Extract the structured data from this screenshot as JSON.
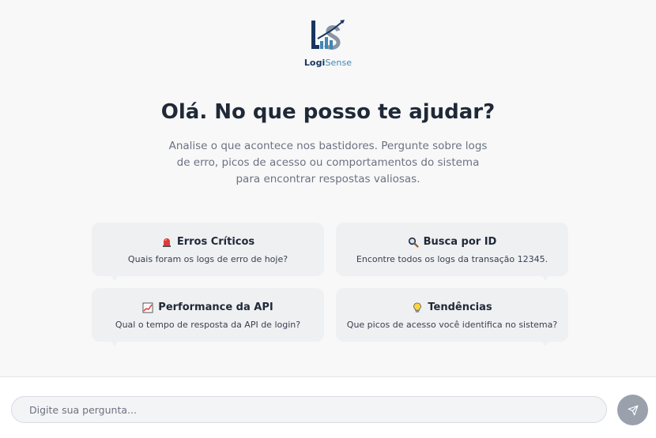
{
  "brand": {
    "name_part1": "Logi",
    "name_part2": "Sense",
    "icon": "logisense-logo"
  },
  "hero": {
    "title": "Olá. No que posso te ajudar?",
    "subtitle": "Analise o que acontece nos bastidores. Pergunte sobre logs de erro, picos de acesso ou comportamentos do sistema para encontrar respostas valiosas."
  },
  "suggestions": [
    {
      "icon": "siren-icon",
      "title": "Erros Críticos",
      "description": "Quais foram os logs de erro de hoje?"
    },
    {
      "icon": "magnifier-icon",
      "title": "Busca por ID",
      "description": "Encontre todos os logs da transação 12345."
    },
    {
      "icon": "chart-increasing-icon",
      "title": "Performance da API",
      "description": "Qual o tempo de resposta da API de login?"
    },
    {
      "icon": "lightbulb-icon",
      "title": "Tendências",
      "description": "Que picos de acesso você identifica no sistema?"
    }
  ],
  "composer": {
    "placeholder": "Digite sua pergunta...",
    "send_icon": "send-icon"
  },
  "colors": {
    "brand_dark": "#17355f",
    "brand_light": "#3f87b6",
    "send_button": "#9aa1ad"
  }
}
